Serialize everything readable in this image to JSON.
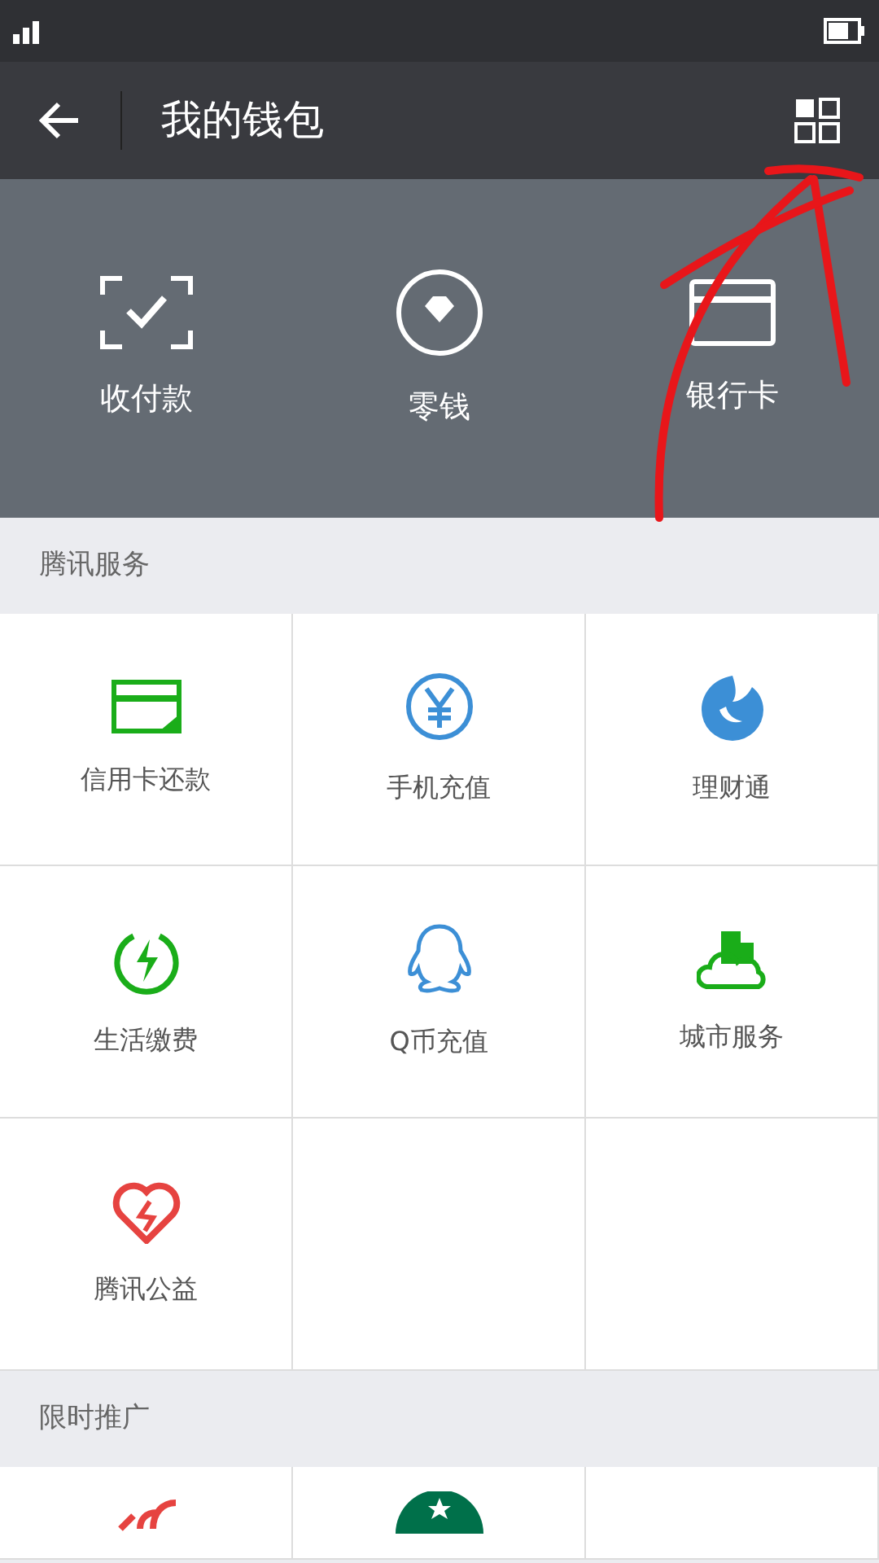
{
  "header": {
    "title": "我的钱包"
  },
  "top_actions": [
    {
      "label": "收付款",
      "kind": "scan"
    },
    {
      "label": "零钱",
      "kind": "change"
    },
    {
      "label": "银行卡",
      "kind": "card"
    }
  ],
  "sections": [
    {
      "title": "腾讯服务",
      "items": [
        {
          "label": "信用卡还款",
          "kind": "creditcard"
        },
        {
          "label": "手机充值",
          "kind": "yen"
        },
        {
          "label": "理财通",
          "kind": "drop"
        },
        {
          "label": "生活缴费",
          "kind": "bolt"
        },
        {
          "label": "Q币充值",
          "kind": "penguin"
        },
        {
          "label": "城市服务",
          "kind": "city"
        },
        {
          "label": "腾讯公益",
          "kind": "heart"
        }
      ]
    },
    {
      "title": "限时推广",
      "items": [
        {
          "kind": "signal"
        },
        {
          "kind": "round-logo"
        },
        {
          "kind": "blank"
        }
      ]
    }
  ]
}
